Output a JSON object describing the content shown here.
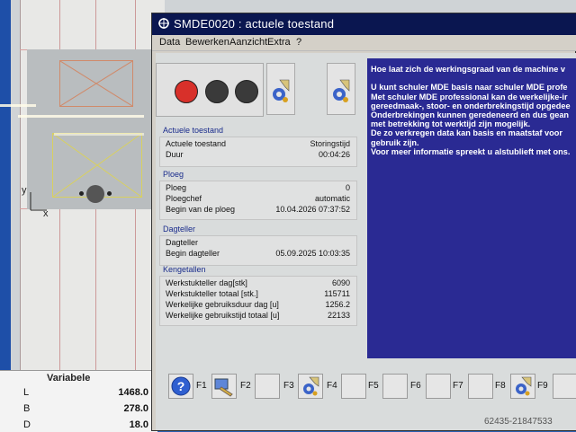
{
  "background_app": {
    "axis_y": "y",
    "axis_x": "x",
    "variables_panel": {
      "header": "Variabele",
      "rows": [
        {
          "key": "L",
          "value": "1468.0"
        },
        {
          "key": "B",
          "value": "278.0"
        },
        {
          "key": "D",
          "value": "18.0"
        }
      ]
    }
  },
  "window": {
    "title": "SMDE0020 : actuele toestand",
    "menu": [
      "Data",
      "Bewerken",
      "Aanzicht",
      "Extra",
      "?"
    ]
  },
  "lamps": {
    "colors": [
      "#d8302a",
      "#3a3a3a",
      "#3a3a3a"
    ],
    "states": [
      "red-on",
      "off",
      "off"
    ]
  },
  "groups": {
    "actuele_toestand": {
      "title": "Actuele toestand",
      "rows": [
        {
          "key": "Actuele toestand",
          "value": "Storingstijd"
        },
        {
          "key": "Duur",
          "value": "00:04:26"
        }
      ]
    },
    "ploeg": {
      "title": "Ploeg",
      "rows": [
        {
          "key": "Ploeg",
          "value": "0"
        },
        {
          "key": "Ploegchef",
          "value": "automatic"
        },
        {
          "key": "Begin van de ploeg",
          "value": "10.04.2026 07:37:52"
        }
      ]
    },
    "dagteller": {
      "title": "Dagteller",
      "rows": [
        {
          "key": "Dagteller",
          "value": ""
        },
        {
          "key": "Begin dagteller",
          "value": "05.09.2025 10:03:35"
        }
      ]
    },
    "kengetallen": {
      "title": "Kengetallen",
      "rows": [
        {
          "key": "Werkstukteller dag[stk]",
          "value": "6090"
        },
        {
          "key": "Werkstukteller totaal [stk.]",
          "value": "115711"
        },
        {
          "key": "Werkelijke gebruiksduur dag [u]",
          "value": "1256.2"
        },
        {
          "key": "Werkelijke gebruikstijd totaal [u]",
          "value": "22133"
        }
      ]
    }
  },
  "info_text": [
    "Hoe laat zich de werkingsgraad van de machine v",
    "",
    "U kunt schuler MDE basis naar schuler MDE profe",
    "Met schuler MDE professional kan de werkelijke-ir",
    "gereedmaak-, stoor- en onderbrekingstijd opgedee",
    "Onderbrekingen kunnen geredeneerd en dus gean",
    "met betrekking tot werktijd zijn mogelijk.",
    "De zo verkregen data kan basis en maatstaf voor",
    "gebruik zijn.",
    "Voor meer informatie spreekt u alstublieft met ons."
  ],
  "function_keys": {
    "labels": [
      "F1",
      "F2",
      "F3",
      "F4",
      "F5",
      "F6",
      "F7",
      "F8",
      "F9"
    ],
    "icons": [
      "help-icon",
      "edit-wrench-icon",
      "",
      "gear-doc-icon",
      "",
      "",
      "",
      "",
      "gear-doc-icon"
    ]
  },
  "serial_watermark": "62435-21847533"
}
